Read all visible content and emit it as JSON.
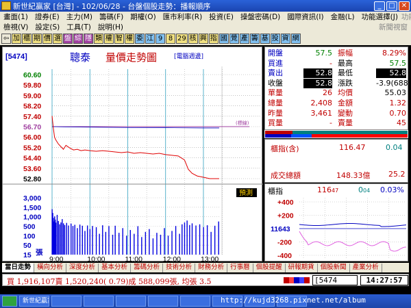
{
  "window": {
    "title": "新世紀贏家 [台灣] - 102/06/28 - 台盤個股走勢：播報順序"
  },
  "menu1": {
    "items": [
      "畫面(1)",
      "證券(E)",
      "主力(M)",
      "籌碼(F)",
      "期權(O)",
      "匯市利率(R)",
      "投資(E)",
      "操盤密碼(D)",
      "國際資訊(I)",
      "金融(L)",
      "功能選擇(J)"
    ],
    "right": "功能選擇"
  },
  "menu2": {
    "items": [
      "檢視(V)",
      "設定(S)",
      "工具(T)",
      "說明(H)"
    ],
    "right": "新聞視窗"
  },
  "toolbar": {
    "buttons": [
      {
        "t": "⇦",
        "bg": "#ece9d8",
        "fg": "#000"
      },
      {
        "t": "加",
        "bg": "#f0e080",
        "fg": "#000"
      },
      {
        "t": "櫃",
        "bg": "#f0e080",
        "fg": "#000"
      },
      {
        "t": "期",
        "bg": "#f0e080",
        "fg": "#000"
      },
      {
        "t": "價",
        "bg": "#f0e080",
        "fg": "#000"
      },
      {
        "t": "選",
        "bg": "#f0e080",
        "fg": "#000"
      },
      {
        "t": "盤",
        "bg": "#a040a0",
        "fg": "#fff"
      },
      {
        "t": "綜",
        "bg": "#a040a0",
        "fg": "#fff"
      },
      {
        "t": "隱",
        "bg": "#a040a0",
        "fg": "#fff"
      },
      {
        "t": "類",
        "bg": "#f0e080",
        "fg": "#000"
      },
      {
        "t": "權",
        "bg": "#f0e080",
        "fg": "#000"
      },
      {
        "t": "智",
        "bg": "#f0e080",
        "fg": "#000"
      },
      {
        "t": "權",
        "bg": "#f0e080",
        "fg": "#000"
      },
      {
        "t": "委",
        "bg": "#80c0f0",
        "fg": "#000"
      },
      {
        "t": "江",
        "bg": "#80c0f0",
        "fg": "#000"
      },
      {
        "t": "9",
        "bg": "#80c0f0",
        "fg": "#000"
      },
      {
        "t": "8",
        "bg": "#f0e080",
        "fg": "#000"
      },
      {
        "t": "29",
        "bg": "#f0e080",
        "fg": "#000"
      },
      {
        "t": "核",
        "bg": "#f0e080",
        "fg": "#000"
      },
      {
        "t": "興",
        "bg": "#f0e080",
        "fg": "#000"
      },
      {
        "t": "指",
        "bg": "#f0e080",
        "fg": "#000"
      },
      {
        "t": "國",
        "bg": "#80c0f0",
        "fg": "#000"
      },
      {
        "t": "覺",
        "bg": "#80c0f0",
        "fg": "#000"
      },
      {
        "t": "產",
        "bg": "#80c0f0",
        "fg": "#000"
      },
      {
        "t": "籌",
        "bg": "#80c0f0",
        "fg": "#000"
      },
      {
        "t": "基",
        "bg": "#80c0f0",
        "fg": "#000"
      },
      {
        "t": "投",
        "bg": "#80c0f0",
        "fg": "#000"
      },
      {
        "t": "資",
        "bg": "#80c0f0",
        "fg": "#000"
      },
      {
        "t": "網",
        "bg": "#80c0f0",
        "fg": "#000"
      }
    ]
  },
  "stock": {
    "code_label": "[5474]",
    "name": "聰泰",
    "chart_title": "量價走勢圖",
    "electronic_tag": "[電腦週邊]",
    "ref_tag": "(標線)",
    "forecast_button": "預測"
  },
  "quote": {
    "rows": [
      [
        {
          "l": "開盤",
          "v": "57.5"
        },
        {
          "l": "振幅",
          "v": "8.29%"
        }
      ],
      [
        {
          "l": "買進",
          "v": "-"
        },
        {
          "l": "最高",
          "v": "57.5"
        }
      ],
      [
        {
          "l": "賣出",
          "v": "52.8"
        },
        {
          "l": "最低",
          "v": "52.8"
        }
      ],
      [
        {
          "l": "收盤",
          "v": "52.8"
        },
        {
          "l": "漲跌",
          "v": "-3.9(688)"
        }
      ],
      [
        {
          "l": "單量",
          "v": "26"
        },
        {
          "l": "均價",
          "v": "55.03"
        }
      ],
      [
        {
          "l": "總量",
          "v": "2,408"
        },
        {
          "l": "金額",
          "v": "1.32"
        }
      ],
      [
        {
          "l": "昨量",
          "v": "3,461"
        },
        {
          "l": "變動",
          "v": "0.70"
        }
      ],
      [
        {
          "l": "買量",
          "v": "-"
        },
        {
          "l": "賣量",
          "v": "45"
        }
      ]
    ]
  },
  "index_box": {
    "label": "櫃指(含)",
    "value": "116.47",
    "change": "0.04",
    "turnover_label": "成交總額",
    "turnover_value": "148.33億",
    "turnover_change": "25.2"
  },
  "mini": {
    "label": "櫃指",
    "value": "116",
    "value_small": "47",
    "change": "0",
    "change_small": "04",
    "pct": "0.03%",
    "ticks": [
      "+400",
      "+200",
      "11643",
      "-200",
      "-400"
    ]
  },
  "chart_data": {
    "type": "line",
    "price_ticks": [
      "60.60",
      "59.80",
      "59.00",
      "58.20",
      "57.40",
      "56.70",
      "56.00",
      "55.20",
      "54.40",
      "53.60",
      "52.80"
    ],
    "volume_ticks": [
      "3,000",
      "1,500",
      "1,000",
      "500",
      "100",
      "50",
      "15",
      "張"
    ],
    "x_ticks": [
      "9:00",
      "10:00",
      "11:00",
      "12:00",
      "13:00"
    ],
    "ylim": [
      52.8,
      60.6
    ],
    "reference_price": 56.7,
    "price": [
      [
        0,
        57.5
      ],
      [
        2,
        56.6
      ],
      [
        4,
        55.9
      ],
      [
        6,
        55.7
      ],
      [
        10,
        55.4
      ],
      [
        14,
        55.2
      ],
      [
        18,
        55.0
      ],
      [
        22,
        55.3
      ],
      [
        28,
        55.1
      ],
      [
        34,
        54.95
      ],
      [
        40,
        55.0
      ],
      [
        46,
        54.9
      ],
      [
        52,
        54.95
      ],
      [
        60,
        54.9
      ],
      [
        70,
        54.85
      ],
      [
        80,
        54.9
      ],
      [
        90,
        54.85
      ],
      [
        100,
        54.8
      ],
      [
        110,
        54.75
      ],
      [
        120,
        54.8
      ],
      [
        130,
        54.7
      ],
      [
        140,
        54.75
      ],
      [
        150,
        54.7
      ],
      [
        160,
        54.65
      ],
      [
        170,
        54.7
      ],
      [
        180,
        54.6
      ],
      [
        190,
        54.55
      ],
      [
        200,
        54.5
      ],
      [
        210,
        54.2
      ],
      [
        216,
        53.5
      ],
      [
        222,
        53.2
      ],
      [
        230,
        53.0
      ],
      [
        240,
        52.9
      ],
      [
        250,
        52.8
      ],
      [
        265,
        52.8
      ]
    ],
    "average": [
      [
        0,
        56.7
      ],
      [
        20,
        56.68
      ],
      [
        60,
        56.66
      ],
      [
        120,
        56.63
      ],
      [
        180,
        56.62
      ],
      [
        240,
        56.6
      ],
      [
        265,
        56.6
      ]
    ],
    "volume": [
      [
        0,
        900
      ],
      [
        1,
        700
      ],
      [
        2,
        450
      ],
      [
        3,
        300
      ],
      [
        4,
        520
      ],
      [
        5,
        380
      ],
      [
        6,
        250
      ],
      [
        8,
        600
      ],
      [
        10,
        320
      ],
      [
        12,
        180
      ],
      [
        14,
        260
      ],
      [
        16,
        400
      ],
      [
        18,
        220
      ],
      [
        20,
        150
      ],
      [
        23,
        240
      ],
      [
        26,
        130
      ],
      [
        30,
        210
      ],
      [
        33,
        110
      ],
      [
        36,
        160
      ],
      [
        40,
        90
      ],
      [
        44,
        170
      ],
      [
        48,
        120
      ],
      [
        52,
        75
      ],
      [
        56,
        130
      ],
      [
        60,
        85
      ],
      [
        64,
        110
      ],
      [
        70,
        95
      ],
      [
        75,
        60
      ],
      [
        80,
        140
      ],
      [
        85,
        70
      ],
      [
        90,
        105
      ],
      [
        96,
        55
      ],
      [
        100,
        120
      ],
      [
        106,
        65
      ],
      [
        112,
        90
      ],
      [
        118,
        50
      ],
      [
        124,
        80
      ],
      [
        130,
        60
      ],
      [
        136,
        100
      ],
      [
        142,
        45
      ],
      [
        148,
        70
      ],
      [
        154,
        85
      ],
      [
        160,
        40
      ],
      [
        166,
        65
      ],
      [
        172,
        55
      ],
      [
        178,
        90
      ],
      [
        184,
        50
      ],
      [
        190,
        75
      ],
      [
        196,
        110
      ],
      [
        202,
        60
      ],
      [
        206,
        180
      ],
      [
        210,
        260
      ],
      [
        214,
        340
      ],
      [
        218,
        150
      ],
      [
        222,
        220
      ],
      [
        228,
        130
      ],
      [
        234,
        180
      ],
      [
        240,
        95
      ],
      [
        246,
        140
      ],
      [
        252,
        70
      ],
      [
        258,
        120
      ],
      [
        264,
        300
      ]
    ]
  },
  "tabs": {
    "items": [
      "當日走勢",
      "橫向分析",
      "深度分析",
      "基本分析",
      "籌碼分析",
      "技術分析",
      "財務分析",
      "行事曆",
      "個股提醒",
      "研報期貨",
      "個股新聞",
      "產業分析"
    ]
  },
  "status": {
    "ticker": "買 1,916,107賣 1,520,240( 0.79)成 588,099張, 均張 3.5",
    "code": "[5474",
    "clock": "14:27:57"
  },
  "taskbar": {
    "items": [
      "",
      "新世紀贏家",
      "",
      "",
      "",
      "",
      "",
      "",
      "",
      ""
    ]
  },
  "watermark": "http://kujd3268.pixnet.net/album"
}
